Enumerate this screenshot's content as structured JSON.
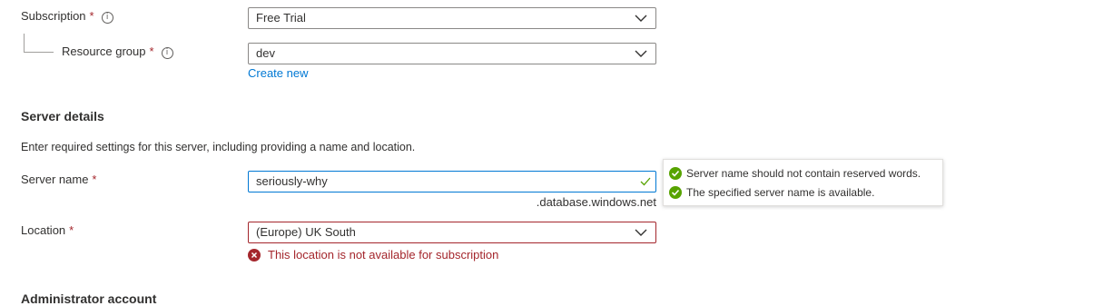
{
  "subscription": {
    "label": "Subscription",
    "required": "*",
    "info": "i",
    "value": "Free Trial"
  },
  "resource_group": {
    "label": "Resource group",
    "required": "*",
    "info": "i",
    "value": "dev",
    "create_new": "Create new"
  },
  "server_details": {
    "heading": "Server details",
    "description": "Enter required settings for this server, including providing a name and location."
  },
  "server_name": {
    "label": "Server name",
    "required": "*",
    "value": "seriously-why",
    "suffix": ".database.windows.net",
    "tooltip": [
      "Server name should not contain reserved words.",
      "The specified server name is available."
    ]
  },
  "location": {
    "label": "Location",
    "required": "*",
    "value": "(Europe) UK South",
    "error": "This location is not available for subscription"
  },
  "admin": {
    "heading": "Administrator account"
  },
  "colors": {
    "accent": "#0078d4",
    "error": "#a4262c",
    "success": "#57a300"
  }
}
